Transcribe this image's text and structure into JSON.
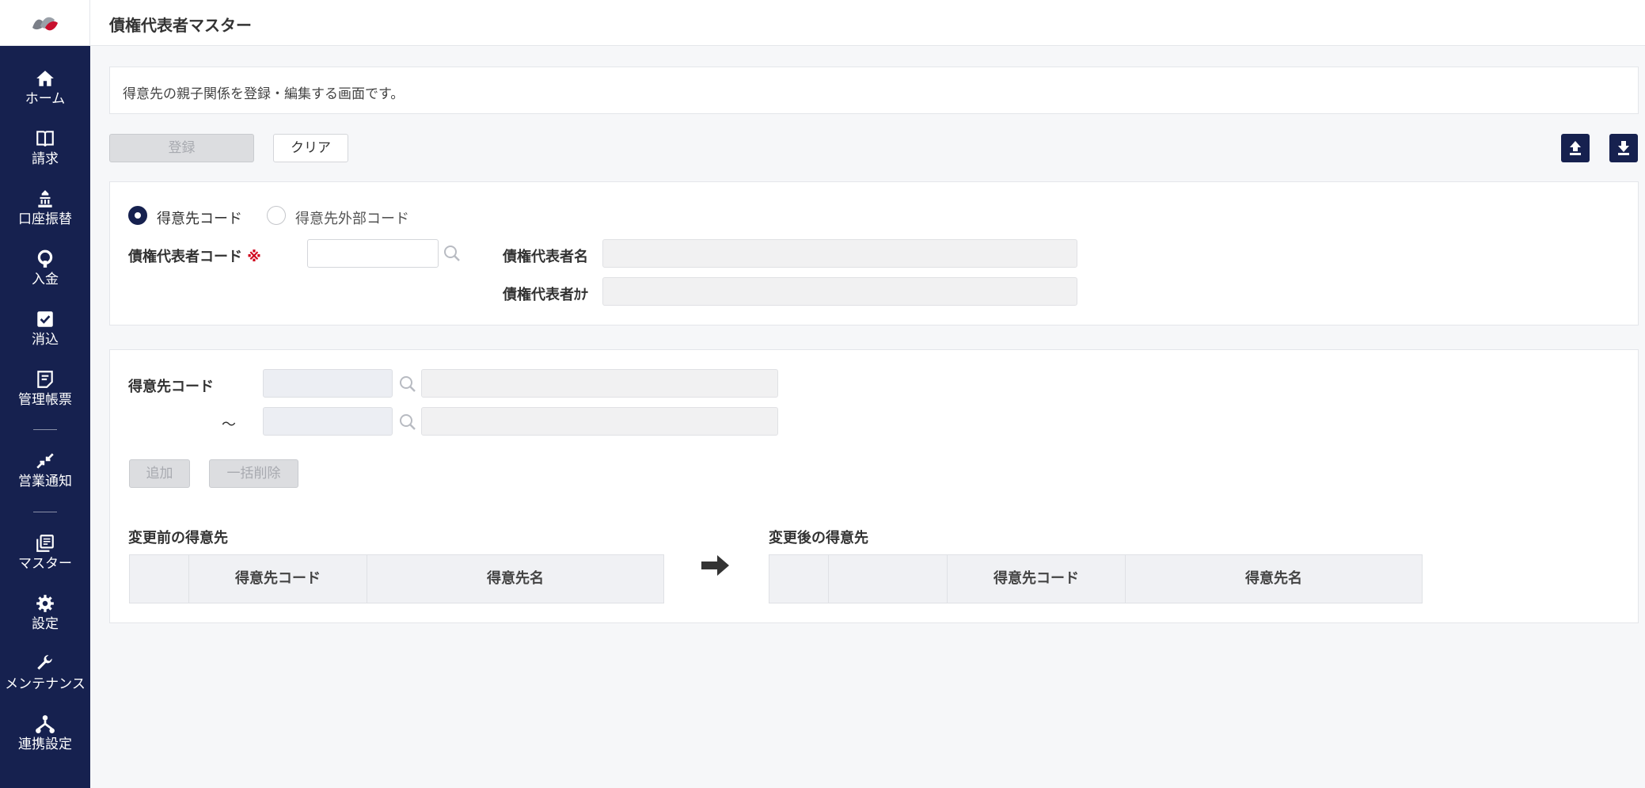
{
  "sidebar": {
    "items": [
      {
        "label": "ホーム",
        "icon": "home-icon"
      },
      {
        "label": "請求",
        "icon": "book-icon"
      },
      {
        "label": "口座振替",
        "icon": "bank-icon"
      },
      {
        "label": "入金",
        "icon": "deposit-icon"
      },
      {
        "label": "消込",
        "icon": "check-square-icon"
      },
      {
        "label": "管理帳票",
        "icon": "report-icon"
      },
      {
        "label": "営業通知",
        "icon": "arrows-in-icon"
      },
      {
        "label": "マスター",
        "icon": "library-icon"
      },
      {
        "label": "設定",
        "icon": "gear-icon"
      },
      {
        "label": "メンテナンス",
        "icon": "wrench-icon"
      },
      {
        "label": "連携設定",
        "icon": "network-icon"
      }
    ]
  },
  "header": {
    "title": "債権代表者マスター"
  },
  "description": "得意先の親子関係を登録・編集する画面です。",
  "toolbar": {
    "register_label": "登録",
    "clear_label": "クリア",
    "upload_icon": "upload-icon",
    "download_icon": "download-icon"
  },
  "form": {
    "radio_customer_code": "得意先コード",
    "radio_external_code": "得意先外部コード",
    "rep_code_label": "債権代表者コード",
    "required_mark": "※",
    "rep_name_label": "債権代表者名",
    "rep_kana_label": "債権代表者ｶﾅ"
  },
  "range": {
    "customer_code_label": "得意先コード",
    "tilde": "～",
    "add_label": "追加",
    "bulk_delete_label": "一括削除"
  },
  "before": {
    "title": "変更前の得意先",
    "columns": [
      "",
      "得意先コード",
      "得意先名"
    ]
  },
  "after": {
    "title": "変更後の得意先",
    "columns": [
      "",
      "",
      "得意先コード",
      "得意先名"
    ]
  },
  "colors": {
    "navy": "#16214f",
    "required": "#d0021b"
  }
}
